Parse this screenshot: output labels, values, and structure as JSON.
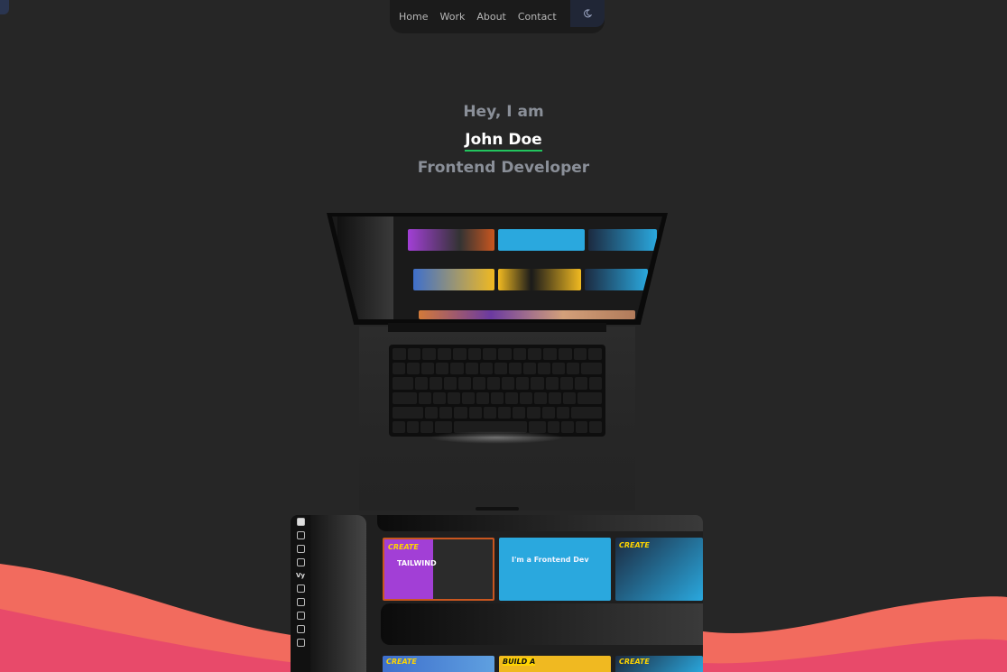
{
  "nav": {
    "items": [
      {
        "label": "Home"
      },
      {
        "label": "Work"
      },
      {
        "label": "About"
      },
      {
        "label": "Contact"
      }
    ],
    "theme_icon": "moon-icon"
  },
  "hero": {
    "greeting": "Hey, I am",
    "name": "John Doe",
    "role": "Frontend Developer"
  },
  "preview": {
    "logo": "Vy",
    "cards": [
      {
        "title": "CREATE",
        "subtitle": "TAILWIND"
      },
      {
        "title": "",
        "subtitle": "I'm a Frontend Dev"
      },
      {
        "title": "CREATE",
        "subtitle": ""
      }
    ],
    "row2": [
      {
        "title": "CREATE"
      },
      {
        "title": "BUILD A"
      },
      {
        "title": "CREATE"
      }
    ]
  },
  "colors": {
    "background": "#262626",
    "accent_underline": "#22c55e",
    "wave_top": "#f26b5e",
    "wave_bottom": "#e84a6a"
  }
}
